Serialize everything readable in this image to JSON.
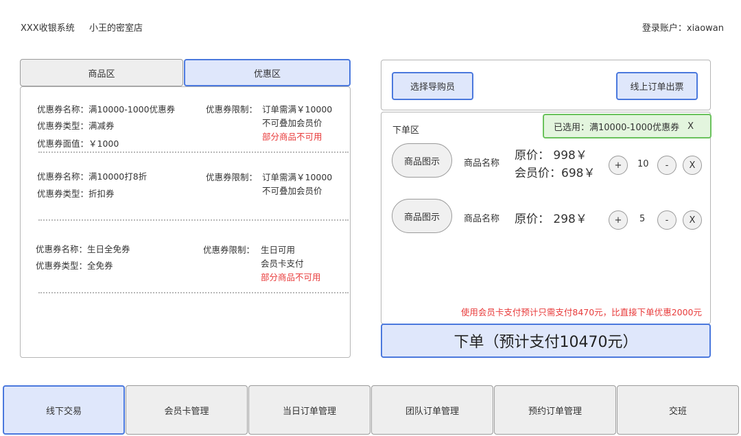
{
  "header": {
    "app_title": "XXX收银系统",
    "store_name": "小王的密室店",
    "login_label": "登录账户：",
    "username": "xiaowan"
  },
  "left_tabs": {
    "goods": "商品区",
    "coupons": "优惠区"
  },
  "coupons": [
    {
      "name": "优惠券名称：满10000-1000优惠券",
      "type": "优惠券类型：满减券",
      "value": "优惠券面值：￥1000",
      "limit_label": "优惠券限制：",
      "limits": [
        "订单需满￥10000",
        "不可叠加会员价"
      ],
      "warning": "部分商品不可用"
    },
    {
      "name": "优惠券名称：满10000打8折",
      "type": "优惠券类型：折扣券",
      "limit_label": "优惠券限制：",
      "limits": [
        "订单需满￥10000",
        "不可叠加会员价"
      ]
    },
    {
      "name": "优惠券名称：生日全免券",
      "type": "优惠券类型：全免券",
      "limit_label": "优惠券限制：",
      "limits": [
        "生日可用",
        "会员卡支付"
      ],
      "warning": "部分商品不可用"
    }
  ],
  "right_top": {
    "guide_button": "选择导购员",
    "print_button": "线上订单出票"
  },
  "order": {
    "label": "下单区",
    "selected_coupon": "已选用：满10000-1000优惠券",
    "selected_close": "X",
    "items": [
      {
        "image_label": "商品图示",
        "name": "商品名称",
        "original_price": "原价：  998￥",
        "member_price": "会员价：698￥",
        "plus": "+",
        "quantity": "10",
        "minus": "-",
        "remove": "X"
      },
      {
        "image_label": "商品图示",
        "name": "商品名称",
        "original_price": "原价：  298￥",
        "plus": "+",
        "quantity": "5",
        "minus": "-",
        "remove": "X"
      }
    ],
    "promo_note": "使用会员卡支付预计只需支付8470元，比直接下单优惠2000元",
    "submit_button": "下单（预计支付10470元）"
  },
  "bottom_nav": [
    {
      "label": "线下交易"
    },
    {
      "label": "会员卡管理"
    },
    {
      "label": "当日订单管理"
    },
    {
      "label": "团队订单管理"
    },
    {
      "label": "预约订单管理"
    },
    {
      "label": "交班"
    }
  ]
}
